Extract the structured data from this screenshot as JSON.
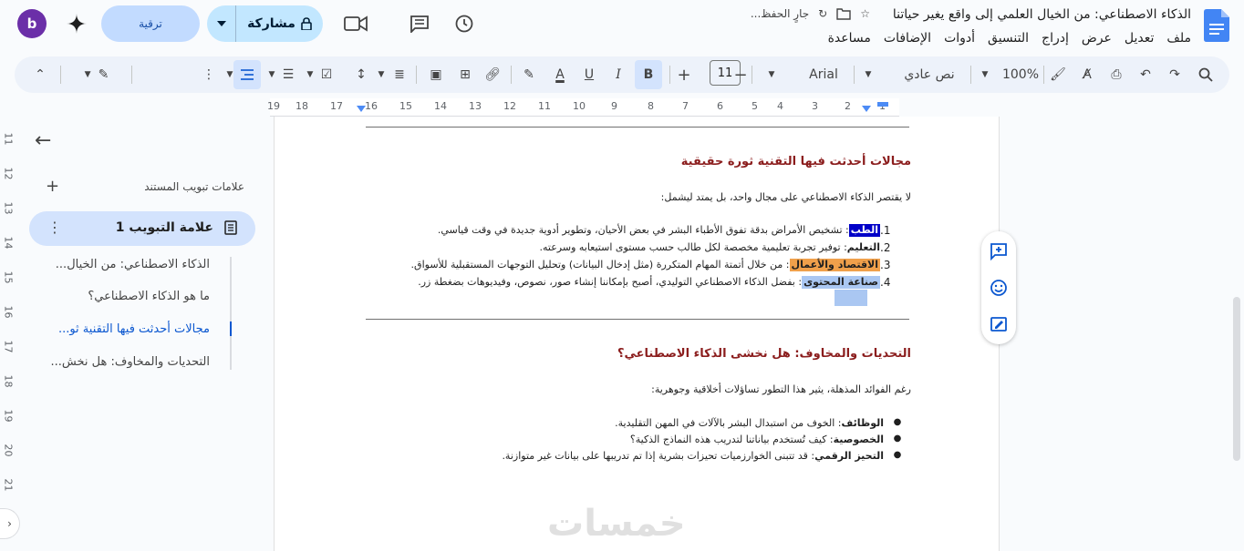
{
  "doc": {
    "title": "الذكاء الاصطناعي: من الخيال العلمي إلى واقع يغير حياتنا",
    "saving": "جارٍ الحفظ..."
  },
  "menu": [
    "ملف",
    "تعديل",
    "عرض",
    "إدراج",
    "التنسيق",
    "أدوات",
    "الإضافات",
    "مساعدة"
  ],
  "header": {
    "avatar_letter": "b",
    "upgrade_label": "ترقية",
    "share_label": "مشاركة"
  },
  "toolbar": {
    "zoom": "100%",
    "style": "نص عادي",
    "font": "Arial",
    "font_size": "11"
  },
  "ruler": [
    "19",
    "18",
    "17",
    "16",
    "15",
    "14",
    "13",
    "12",
    "11",
    "10",
    "9",
    "8",
    "7",
    "6",
    "5",
    "4",
    "3",
    "2",
    "1"
  ],
  "vruler": [
    "11",
    "12",
    "13",
    "14",
    "15",
    "16",
    "17",
    "18",
    "19",
    "20",
    "21"
  ],
  "outline": {
    "tabs_label": "علامات تبويب المستند",
    "tab_name": "علامة التبويب 1",
    "items": [
      "الذكاء الاصطناعي: من الخيال...",
      "ما هو الذكاء الاصطناعي؟",
      "مجالات أحدثت فيها التقنية ثو...",
      "التحديات والمخاوف: هل نخش..."
    ]
  },
  "content": {
    "h_fields": "مجالات أحدثت فيها التقنية ثورة حقيقية",
    "p_intro": "لا يقتصر الذكاء الاصطناعي على مجال واحد، بل يمتد ليشمل:",
    "list": [
      {
        "num": "1.",
        "term": "الطب",
        "text": ": تشخيص الأمراض بدقة تفوق الأطباء البشر في بعض الأحيان، وتطوير أدوية جديدة في وقت قياسي."
      },
      {
        "num": "2.",
        "term": "التعليم",
        "text": ": توفير تجربة تعليمية مخصصة لكل طالب حسب مستوى استيعابه وسرعته."
      },
      {
        "num": "3.",
        "term": "الاقتصاد والأعمال",
        "text": ": من خلال أتمتة المهام المتكررة (مثل إدخال البيانات) وتحليل التوجهات المستقبلية للأسواق."
      },
      {
        "num": "4.",
        "term": "صناعة المحتوى",
        "text": ": بفضل الذكاء الاصطناعي التوليدي، أصبح بإمكاننا إنشاء صور، نصوص، وفيديوهات بضغطة زر."
      }
    ],
    "h_challenges": "التحديات والمخاوف: هل نخشى الذكاء الاصطناعي؟",
    "p_challenges": "رغم الفوائد المذهلة، يثير هذا التطور تساؤلات أخلاقية وجوهرية:",
    "bullets": [
      {
        "term": "الوظائف",
        "text": ": الخوف من استبدال البشر بالآلات في المهن التقليدية."
      },
      {
        "term": "الخصوصية",
        "text": ": كيف تُستخدم بياناتنا لتدريب هذه النماذج الذكية؟"
      },
      {
        "term": "التحيز الرقمي",
        "text": ": قد تتبنى الخوارزميات تحيزات بشرية إذا تم تدريبها على بيانات غير متوازنة."
      }
    ]
  },
  "watermark": "خمسات",
  "colors": {
    "heading": "#8b1d1d",
    "accent": "#0b57d0",
    "highlight_blue": "#0000c8",
    "highlight_orange": "#f0a04b"
  }
}
